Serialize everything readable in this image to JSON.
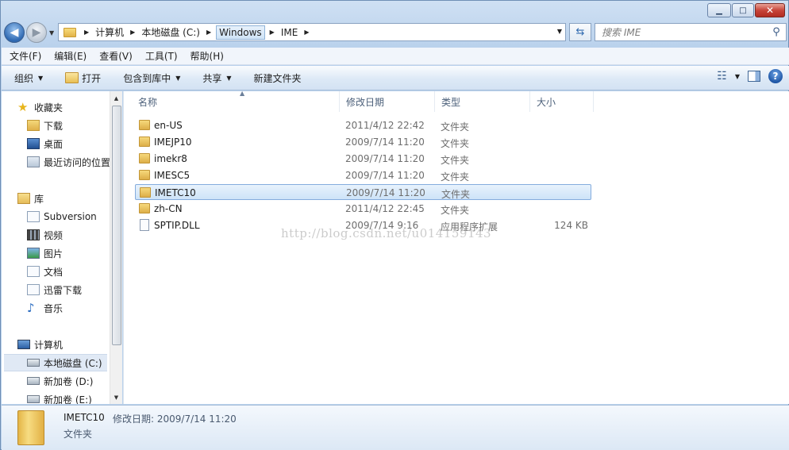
{
  "window": {
    "min_glyph": "▁",
    "max_glyph": "□",
    "close_glyph": "✕"
  },
  "address": {
    "crumbs": [
      "计算机",
      "本地磁盘 (C:)",
      "Windows",
      "IME"
    ],
    "separator": "▶"
  },
  "search": {
    "placeholder": "搜索 IME"
  },
  "menu": [
    "文件(F)",
    "编辑(E)",
    "查看(V)",
    "工具(T)",
    "帮助(H)"
  ],
  "commands": {
    "organize": "组织",
    "open": "打开",
    "include_library": "包含到库中",
    "share": "共享",
    "new_folder": "新建文件夹"
  },
  "nav": {
    "favorites": "收藏夹",
    "downloads": "下载",
    "desktop": "桌面",
    "recent": "最近访问的位置",
    "libraries": "库",
    "subversion": "Subversion",
    "videos": "视频",
    "pictures": "图片",
    "documents": "文档",
    "xunlei": "迅雷下载",
    "music": "音乐",
    "computer": "计算机",
    "drive_c": "本地磁盘 (C:)",
    "drive_d": "新加卷 (D:)",
    "drive_e": "新加卷 (E:)"
  },
  "columns": {
    "name": "名称",
    "date": "修改日期",
    "type": "类型",
    "size": "大小"
  },
  "files": [
    {
      "name": "en-US",
      "date": "2011/4/12 22:42",
      "type": "文件夹",
      "size": ""
    },
    {
      "name": "IMEJP10",
      "date": "2009/7/14 11:20",
      "type": "文件夹",
      "size": ""
    },
    {
      "name": "imekr8",
      "date": "2009/7/14 11:20",
      "type": "文件夹",
      "size": ""
    },
    {
      "name": "IMESC5",
      "date": "2009/7/14 11:20",
      "type": "文件夹",
      "size": ""
    },
    {
      "name": "IMETC10",
      "date": "2009/7/14 11:20",
      "type": "文件夹",
      "size": ""
    },
    {
      "name": "zh-CN",
      "date": "2011/4/12 22:45",
      "type": "文件夹",
      "size": ""
    },
    {
      "name": "SPTIP.DLL",
      "date": "2009/7/14 9:16",
      "type": "应用程序扩展",
      "size": "124 KB"
    }
  ],
  "selected_index": 4,
  "watermark": "http://blog.csdn.net/u014159143",
  "details": {
    "name": "IMETC10",
    "meta": "修改日期: 2009/7/14 11:20",
    "type": "文件夹"
  },
  "colors": {
    "selection": "#cde3f8",
    "accent": "#2f69b2"
  }
}
